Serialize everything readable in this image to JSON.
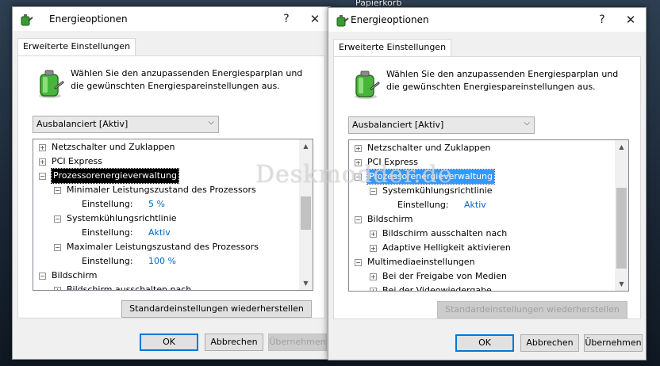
{
  "desktop": {
    "icon_label": "Papierkorb"
  },
  "watermark": "Deskmodder.de",
  "left": {
    "title": "Energieoptionen",
    "help": "?",
    "close": "✕",
    "tab": "Erweiterte Einstellungen",
    "intro": "Wählen Sie den anzupassenden Energiesparplan und die gewünschten Energiespareinstellungen aus.",
    "plan": "Ausbalanciert [Aktiv]",
    "tree": [
      {
        "exp": "+",
        "label": "Netzschalter und Zuklappen"
      },
      {
        "exp": "+",
        "label": "PCI Express"
      },
      {
        "exp": "−",
        "label": "Prozessorenergieverwaltung"
      },
      {
        "exp": "−",
        "label": "Minimaler Leistungszustand des Prozessors"
      },
      {
        "setting": "Einstellung:",
        "value": "5 %"
      },
      {
        "exp": "−",
        "label": "Systemkühlungsrichtlinie"
      },
      {
        "setting": "Einstellung:",
        "value": "Aktiv"
      },
      {
        "exp": "−",
        "label": "Maximaler Leistungszustand des Prozessors"
      },
      {
        "setting": "Einstellung:",
        "value": "100 %"
      },
      {
        "exp": "−",
        "label": "Bildschirm"
      },
      {
        "exp": "+",
        "label": "Bildschirm ausschalten nach"
      }
    ],
    "restore": "Standardeinstellungen wiederherstellen",
    "ok": "OK",
    "cancel": "Abbrechen",
    "apply": "Übernehmen"
  },
  "right": {
    "title": "Energieoptionen",
    "help": "?",
    "close": "✕",
    "tab": "Erweiterte Einstellungen",
    "intro": "Wählen Sie den anzupassenden Energiesparplan und die gewünschten Energiespareinstellungen aus.",
    "plan": "Ausbalanciert [Aktiv]",
    "tree": [
      {
        "exp": "+",
        "label": "Netzschalter und Zuklappen"
      },
      {
        "exp": "+",
        "label": "PCI Express"
      },
      {
        "exp": "−",
        "label": "Prozessorenergieverwaltung"
      },
      {
        "exp": "−",
        "label": "Systemkühlungsrichtlinie"
      },
      {
        "setting": "Einstellung:",
        "value": "Aktiv"
      },
      {
        "exp": "−",
        "label": "Bildschirm"
      },
      {
        "exp": "+",
        "label": "Bildschirm ausschalten nach"
      },
      {
        "exp": "+",
        "label": "Adaptive Helligkeit aktivieren"
      },
      {
        "exp": "−",
        "label": "Multimediaeinstellungen"
      },
      {
        "exp": "+",
        "label": "Bei der Freigabe von Medien"
      },
      {
        "exp": "+",
        "label": "Bei der Videowiedergabe"
      }
    ],
    "restore": "Standardeinstellungen wiederherstellen",
    "ok": "OK",
    "cancel": "Abbrechen",
    "apply": "Übernehmen"
  }
}
